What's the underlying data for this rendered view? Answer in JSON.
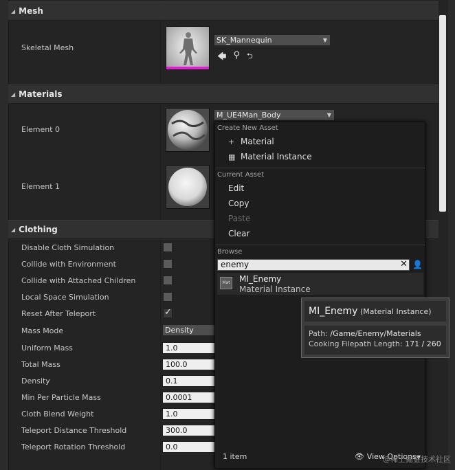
{
  "sections": {
    "mesh": "Mesh",
    "materials": "Materials",
    "clothing": "Clothing"
  },
  "mesh": {
    "label": "Skeletal Mesh",
    "value": "SK_Mannequin"
  },
  "materials": {
    "element0": {
      "label": "Element 0",
      "value": "M_UE4Man_Body"
    },
    "element1": {
      "label": "Element 1"
    }
  },
  "clothing": {
    "disable_cloth": "Disable Cloth Simulation",
    "collide_env": "Collide with Environment",
    "collide_children": "Collide with Attached Children",
    "local_space": "Local Space Simulation",
    "reset_teleport": "Reset After Teleport",
    "mass_mode": "Mass Mode",
    "mass_mode_value": "Density",
    "uniform_mass": "Uniform Mass",
    "uniform_mass_value": "1.0",
    "total_mass": "Total Mass",
    "total_mass_value": "100.0",
    "density": "Density",
    "density_value": "0.1",
    "min_particle_mass": "Min Per Particle Mass",
    "min_particle_mass_value": "0.0001",
    "blend_weight": "Cloth Blend Weight",
    "blend_weight_value": "1.0",
    "teleport_dist": "Teleport Distance Threshold",
    "teleport_dist_value": "300.0",
    "teleport_rot": "Teleport Rotation Threshold",
    "teleport_rot_value": "0.0"
  },
  "menu": {
    "create_heading": "Create New Asset",
    "material": "Material",
    "material_instance": "Material Instance",
    "current_heading": "Current Asset",
    "edit": "Edit",
    "copy": "Copy",
    "paste": "Paste",
    "clear": "Clear",
    "browse_heading": "Browse",
    "search_value": "enemy",
    "result_name": "MI_Enemy",
    "result_type": "Material Instance",
    "result_icon_text": "Mat",
    "item_count": "1 item",
    "view_options": "View Options"
  },
  "tooltip": {
    "title": "MI_Enemy",
    "kind": "(Material Instance)",
    "path_label": "Path:",
    "path_value": "/Game/Enemy/Materials",
    "length_label": "Cooking Filepath Length:",
    "length_value": "171 / 260"
  },
  "watermark": "@稀土掘金技术社区"
}
